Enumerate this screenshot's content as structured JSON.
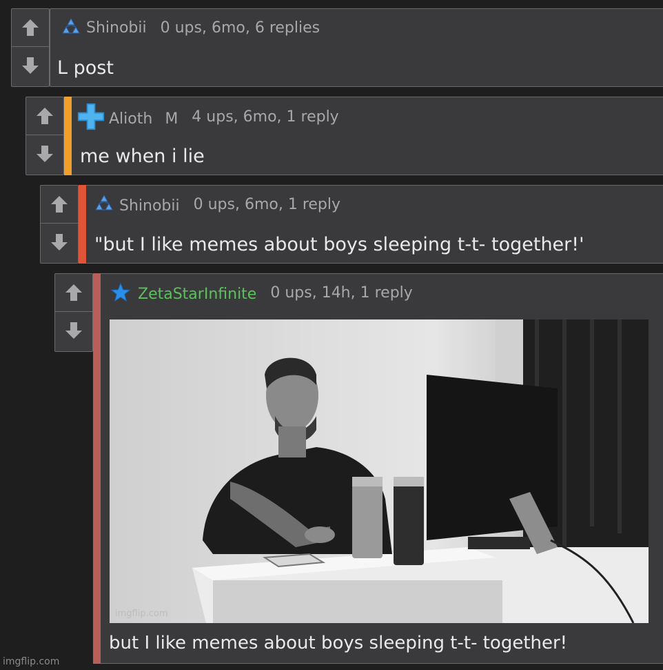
{
  "comments": [
    {
      "username": "Shinobii",
      "badge": "",
      "stats": "0 ups, 6mo, 6 replies",
      "text": "L post",
      "user_color": "#a8a8aa",
      "icon": "triangle-rank-icon"
    },
    {
      "username": "Alioth",
      "badge": "M",
      "stats": "4 ups, 6mo, 1 reply",
      "text": "me when i lie",
      "user_color": "#a8a8aa",
      "accent_color": "#f0a02a",
      "icon": "blue-cross-icon"
    },
    {
      "username": "Shinobii",
      "badge": "",
      "stats": "0 ups, 6mo, 1 reply",
      "text": "\"but I like memes about boys sleeping t-t- together!'",
      "user_color": "#a8a8aa",
      "accent_color": "#e0553a",
      "icon": "triangle-rank-icon"
    },
    {
      "username": "ZetaStarInfinite",
      "badge": "",
      "stats": "0 ups, 14h, 1 reply",
      "text": "but I like memes about boys sleeping t-t- together!",
      "user_color": "#5cc05c",
      "accent_color": "#b85f58",
      "icon": "star-icon",
      "image_watermark": "imgflip.com"
    }
  ],
  "footer_watermark": "imgflip.com"
}
